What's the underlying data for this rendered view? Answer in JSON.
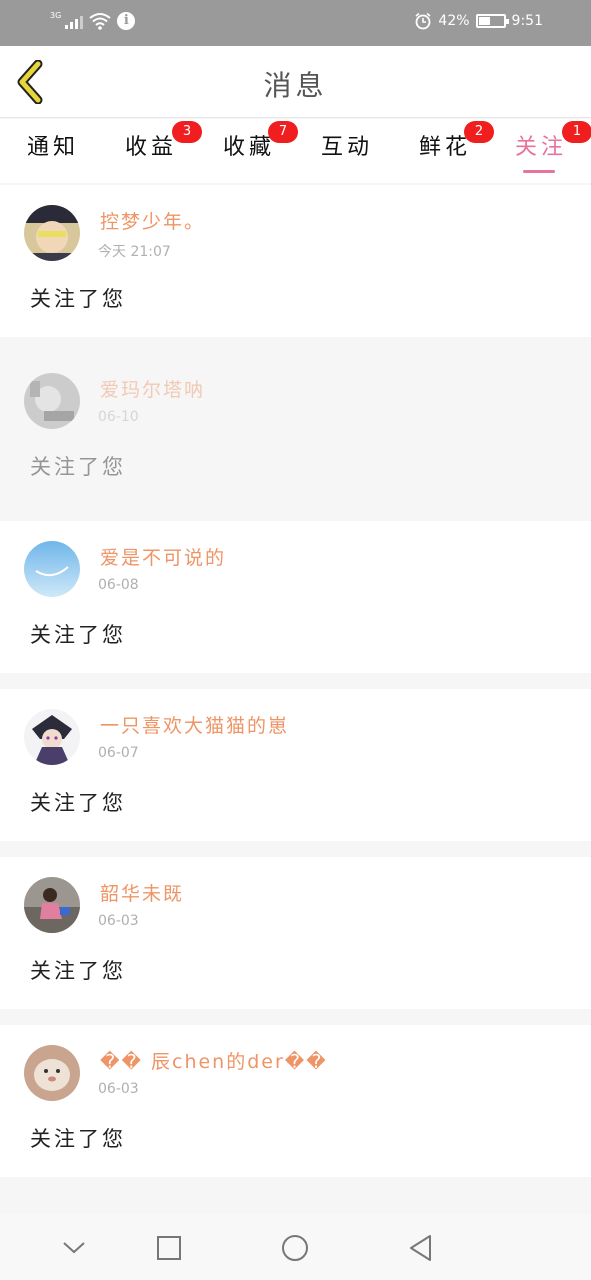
{
  "status_bar": {
    "network": "3G",
    "battery_percent": "42%",
    "battery_level": 0.42,
    "time": "9:51"
  },
  "header": {
    "title": "消息"
  },
  "tabs": [
    {
      "label": "通知",
      "badge": ""
    },
    {
      "label": "收益",
      "badge": "3"
    },
    {
      "label": "收藏",
      "badge": "7"
    },
    {
      "label": "互动",
      "badge": ""
    },
    {
      "label": "鲜花",
      "badge": "2"
    },
    {
      "label": "关注",
      "badge": "1",
      "active": true
    }
  ],
  "notifications": [
    {
      "name": "控梦少年。",
      "date": "今天 21:07",
      "message": "关注了您"
    },
    {
      "name": "爱玛尔塔呐",
      "date": "06-10",
      "message": "关注了您"
    },
    {
      "name": "爱是不可说的",
      "date": "06-08",
      "message": "关注了您"
    },
    {
      "name": "一只喜欢大猫猫的崽",
      "date": "06-07",
      "message": "关注了您"
    },
    {
      "name": "韶华未既",
      "date": "06-03",
      "message": "关注了您"
    },
    {
      "name": "�� 辰chen的der��",
      "date": "06-03",
      "message": "关注了您"
    }
  ],
  "colors": {
    "accent": "#e8739e",
    "username": "#ef9466",
    "badge": "#f01e1e",
    "back_arrow": "#e6d63a"
  }
}
